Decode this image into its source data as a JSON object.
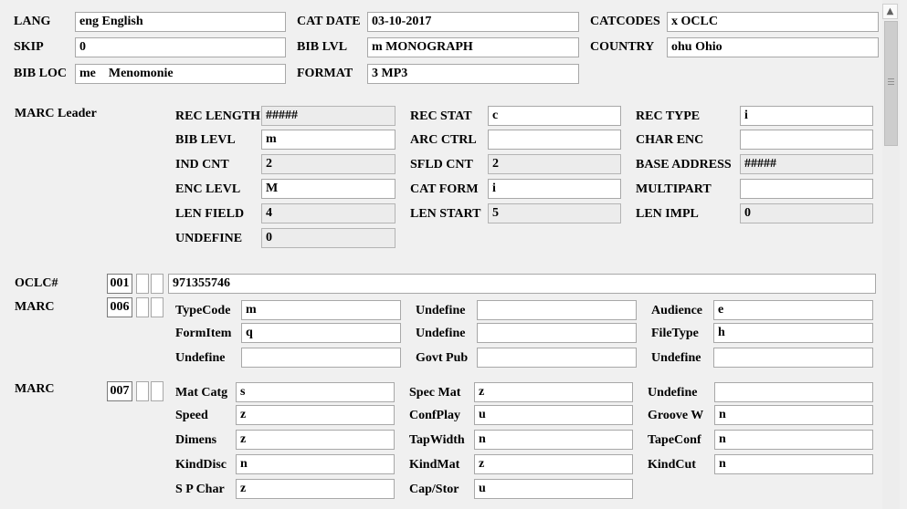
{
  "top": {
    "lang_label": "LANG",
    "lang_value": "eng English",
    "catdate_label": "CAT DATE",
    "catdate_value": "03-10-2017",
    "catcodes_label": "CATCODES",
    "catcodes_value": "x OCLC",
    "skip_label": "SKIP",
    "skip_value": "0",
    "biblvl_label": "BIB LVL",
    "biblvl_value": "m MONOGRAPH",
    "country_label": "COUNTRY",
    "country_value": "ohu Ohio",
    "bibloc_label": "BIB LOC",
    "bibloc_value": "me    Menomonie",
    "format_label": "FORMAT",
    "format_value": "3 MP3"
  },
  "leader": {
    "title": "MARC Leader",
    "rec_length_label": "REC LENGTH",
    "rec_length_value": "#####",
    "rec_stat_label": "REC STAT",
    "rec_stat_value": "c",
    "rec_type_label": "REC TYPE",
    "rec_type_value": "i",
    "bib_levl_label": "BIB LEVL",
    "bib_levl_value": "m",
    "arc_ctrl_label": "ARC CTRL",
    "arc_ctrl_value": "",
    "char_enc_label": "CHAR ENC",
    "char_enc_value": "",
    "ind_cnt_label": "IND CNT",
    "ind_cnt_value": "2",
    "sfld_cnt_label": "SFLD CNT",
    "sfld_cnt_value": "2",
    "base_address_label": "BASE ADDRESS",
    "base_address_value": "#####",
    "enc_levl_label": "ENC LEVL",
    "enc_levl_value": "M",
    "cat_form_label": "CAT FORM",
    "cat_form_value": "i",
    "multipart_label": "MULTIPART",
    "multipart_value": "",
    "len_field_label": "LEN FIELD",
    "len_field_value": "4",
    "len_start_label": "LEN START",
    "len_start_value": "5",
    "len_impl_label": "LEN IMPL",
    "len_impl_value": "0",
    "undefine_label": "UNDEFINE",
    "undefine_value": "0"
  },
  "oclc": {
    "label": "OCLC#",
    "tag": "001",
    "value": "971355746"
  },
  "m006": {
    "label": "MARC",
    "tag": "006",
    "typecode_label": "TypeCode",
    "typecode_value": "m",
    "undefine1_label": "Undefine",
    "undefine1_value": "",
    "audience_label": "Audience",
    "audience_value": "e",
    "formitem_label": "FormItem",
    "formitem_value": "q",
    "undefine2_label": "Undefine",
    "undefine2_value": "",
    "filetype_label": "FileType",
    "filetype_value": "h",
    "undefine3_label": "Undefine",
    "undefine3_value": "",
    "govtpub_label": "Govt Pub",
    "govtpub_value": "",
    "undefine4_label": "Undefine",
    "undefine4_value": ""
  },
  "m007": {
    "label": "MARC",
    "tag": "007",
    "matcatg_label": "Mat Catg",
    "matcatg_value": "s",
    "specmat_label": "Spec Mat",
    "specmat_value": "z",
    "undefine_label": "Undefine",
    "undefine_value": "",
    "speed_label": "Speed",
    "speed_value": "z",
    "confplay_label": "ConfPlay",
    "confplay_value": "u",
    "groovew_label": "Groove W",
    "groovew_value": "n",
    "dimens_label": "Dimens",
    "dimens_value": "z",
    "tapwidth_label": "TapWidth",
    "tapwidth_value": "n",
    "tapeconf_label": "TapeConf",
    "tapeconf_value": "n",
    "kinddisc_label": "KindDisc",
    "kinddisc_value": "n",
    "kindmat_label": "KindMat",
    "kindmat_value": "z",
    "kindcut_label": "KindCut",
    "kindcut_value": "n",
    "spchar_label": "S P Char",
    "spchar_value": "z",
    "capstor_label": "Cap/Stor",
    "capstor_value": "u"
  },
  "scrollbar": {
    "up_icon": "arrow-up-icon"
  }
}
